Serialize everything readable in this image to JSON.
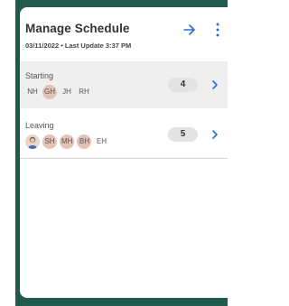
{
  "header": {
    "title": "Manage Schedule",
    "subtitle": "03/11/2022 • Last Update 3:37 PM"
  },
  "rows": [
    {
      "label": "Starting",
      "chips": [
        {
          "text": "NH",
          "highlight": false
        },
        {
          "text": "GH",
          "highlight": true
        },
        {
          "text": "JH",
          "highlight": false
        },
        {
          "text": "RH",
          "highlight": false
        }
      ],
      "count": "4"
    },
    {
      "label": "Leaving",
      "chips": [
        {
          "text": "SH",
          "highlight": true
        },
        {
          "text": "MH",
          "highlight": true
        },
        {
          "text": "BH",
          "highlight": true
        },
        {
          "text": "EH",
          "highlight": false
        }
      ],
      "count": "5"
    }
  ],
  "icons": {
    "go": "arrow-right-icon",
    "more": "more-vertical-icon",
    "chevron": "chevron-right-icon",
    "avatar": "person-avatar-icon"
  },
  "colors": {
    "frame": "#1f5a4c",
    "accent": "#2b6fd6",
    "chip_highlight": "#e4c3b6",
    "row_highlight": "#efefef"
  }
}
